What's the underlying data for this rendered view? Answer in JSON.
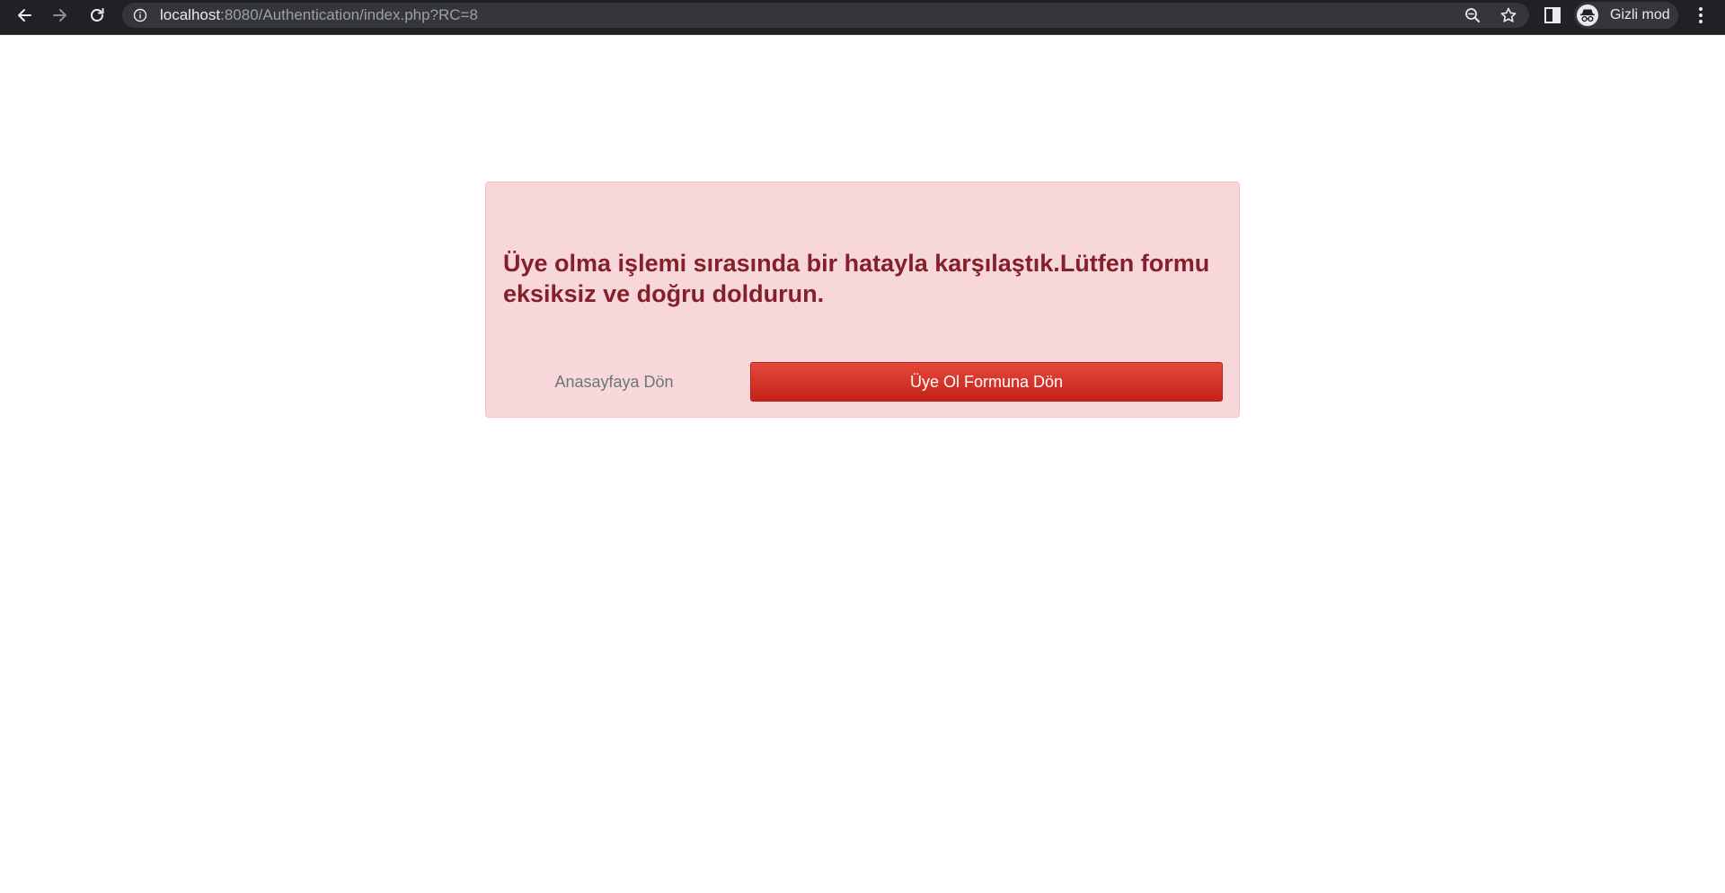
{
  "browser": {
    "url_host": "localhost",
    "url_rest": ":8080/Authentication/index.php?RC=8",
    "profile_label": "Gizli mod",
    "icons": [
      "back-arrow-icon",
      "forward-arrow-icon",
      "reload-icon",
      "site-info-icon",
      "zoom-out-icon",
      "bookmark-star-icon",
      "side-panel-icon",
      "incognito-icon",
      "more-menu-icon"
    ]
  },
  "alert": {
    "message": "Üye olma işlemi sırasında bir hatayla karşılaştık.Lütfen formu eksiksiz ve doğru doldurun.",
    "home_button_label": "Anasayfaya Dön",
    "signup_button_label": "Üye Ol Formuna Dön"
  },
  "colors": {
    "alert_background": "#f8d7da",
    "alert_text": "#842029",
    "primary_button": "#d9352a",
    "chrome_background": "#202124"
  }
}
